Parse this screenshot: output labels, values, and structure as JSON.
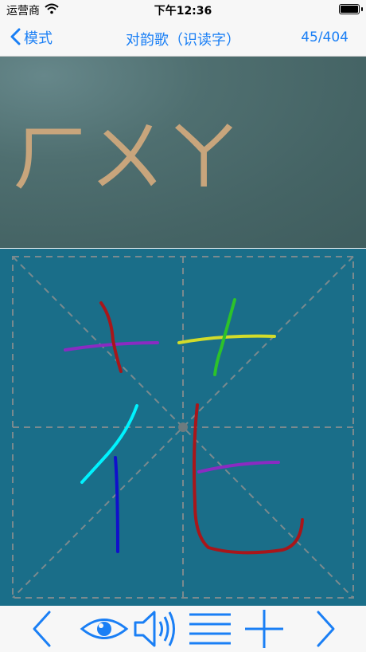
{
  "status": {
    "carrier": "运营商",
    "time": "下午12:36"
  },
  "nav": {
    "back_label": "模式",
    "title": "对韵歌（识读字）",
    "counter": "45/404"
  },
  "board": {
    "pinyin": "ㄏㄨㄚ"
  },
  "colors": {
    "accent": "#1a7ff5",
    "board": "#4f6f70",
    "canvas": "#1a6e89",
    "chalk": "#c8a57c"
  },
  "toolbar": {
    "icons": [
      "chevron-left-icon",
      "eye-icon",
      "speaker-icon",
      "menu-lines-icon",
      "plus-icon",
      "chevron-right-icon"
    ]
  }
}
